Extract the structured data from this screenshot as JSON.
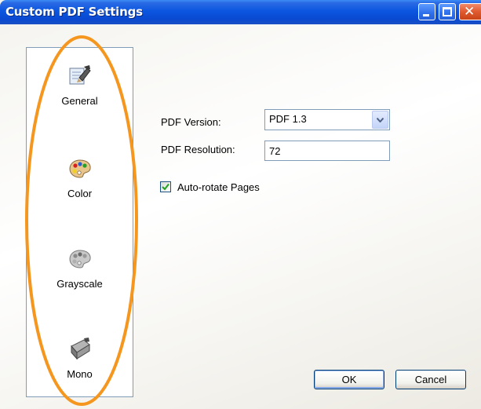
{
  "window": {
    "title": "Custom PDF Settings"
  },
  "title_buttons": {
    "minimize_icon": "minimize-icon",
    "maximize_icon": "maximize-icon",
    "close_icon": "close-icon",
    "close_glyph": "✕"
  },
  "categories": [
    {
      "label": "General",
      "icon": "general-settings-icon"
    },
    {
      "label": "Color",
      "icon": "color-palette-icon"
    },
    {
      "label": "Grayscale",
      "icon": "grayscale-palette-icon"
    },
    {
      "label": "Mono",
      "icon": "mono-icon"
    }
  ],
  "form": {
    "pdf_version_label": "PDF Version:",
    "pdf_version_value": "PDF 1.3",
    "pdf_resolution_label": "PDF Resolution:",
    "pdf_resolution_value": "72",
    "auto_rotate_label": "Auto-rotate Pages",
    "auto_rotate_checked": true
  },
  "buttons": {
    "ok_label": "OK",
    "cancel_label": "Cancel"
  },
  "colors": {
    "titlebar": "#0b56e0",
    "annotation": "#f5961e",
    "field_border": "#7f9db9",
    "checkmark": "#21a121"
  }
}
